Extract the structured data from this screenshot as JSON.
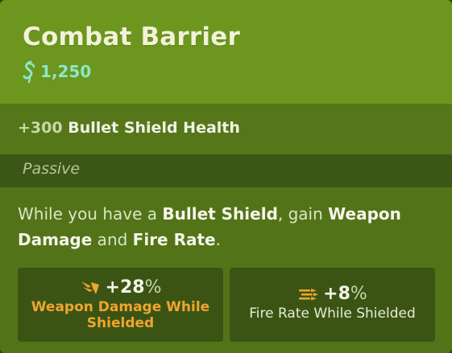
{
  "item": {
    "title": "Combat Barrier",
    "cost": "1,250"
  },
  "stat": {
    "plus": "+300",
    "label": "Bullet Shield Health"
  },
  "section_label": "Passive",
  "description": {
    "t1": "While you have a ",
    "b1": "Bullet Shield",
    "t2": ", gain ",
    "b2": "Weapon Damage",
    "t3": " and ",
    "b3": "Fire Rate",
    "t4": "."
  },
  "bonuses": [
    {
      "value": "+28",
      "unit": "%",
      "label_line1": "Weapon Damage While",
      "label_line2": "Shielded",
      "icon": "weapon-damage-icon"
    },
    {
      "value": "+8",
      "unit": "%",
      "label_line1": "Fire Rate While Shielded",
      "icon": "fire-rate-icon"
    }
  ],
  "colors": {
    "header": "#6d961e",
    "cost": "#8de7c7",
    "weapon_accent": "#f0a52f"
  }
}
